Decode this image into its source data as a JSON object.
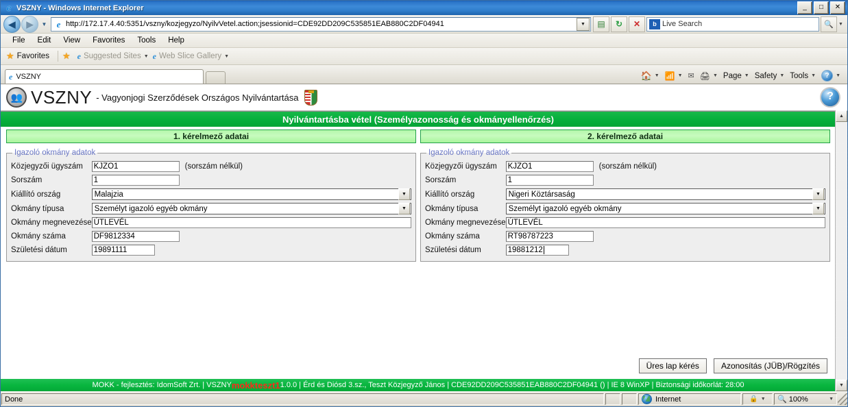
{
  "window": {
    "title": "VSZNY - Windows Internet Explorer",
    "minimize_label": "_",
    "maximize_label": "□",
    "close_label": "✕"
  },
  "nav": {
    "back_label": "◀",
    "forward_label": "▶",
    "recent_caret": "▼",
    "url": "http://172.17.4.40:5351/vszny/kozjegyzo/NyilvVetel.action;jsessionid=CDE92DD209C535851EAB880C2DF04941",
    "url_dropdown_label": "▼",
    "compat_icon": "compatibility-view-icon",
    "refresh_label": "↻",
    "stop_label": "✕",
    "search_brand": "b",
    "search_placeholder": "Live Search",
    "search_go_label": "🔍",
    "search_caret": "▼"
  },
  "menu": {
    "items": [
      "File",
      "Edit",
      "View",
      "Favorites",
      "Tools",
      "Help"
    ]
  },
  "favbar": {
    "favorites_label": "Favorites",
    "add_label": "",
    "suggested_sites": "Suggested Sites",
    "web_slice_gallery": "Web Slice Gallery",
    "caret": "▼"
  },
  "tabs": {
    "browser_tab_label": "VSZNY",
    "new_tab_label": ""
  },
  "commandbar": {
    "home_caret": "▼",
    "feeds_caret": "▼",
    "print_caret": "▼",
    "page": "Page",
    "safety": "Safety",
    "tools": "Tools",
    "help_label": "?",
    "caret": "▼"
  },
  "app": {
    "brand": "VSZNY",
    "brand_subtitle": "- Vagyonjogi Szerződések Országos Nyilvántartása",
    "help_label": "?",
    "page_title": "Nyilvántartásba vétel (Személyazonosság és okmányellenőrzés)"
  },
  "applicant_tabs": [
    {
      "label": "1. kérelmező adatai"
    },
    {
      "label": "2. kérelmező adatai"
    }
  ],
  "panels": [
    {
      "legend": "Igazoló okmány adatok",
      "fields": {
        "kozjegyzoi_ugyszam": {
          "label": "Közjegyzői ügyszám",
          "value": "KJZO1",
          "hint": "(sorszám nélkül)"
        },
        "sorszam": {
          "label": "Sorszám",
          "value": "1"
        },
        "kiallito_orszag": {
          "label": "Kiállító ország",
          "value": "Malajzia"
        },
        "okmany_tipusa": {
          "label": "Okmány típusa",
          "value": "Személyt igazoló egyéb okmány"
        },
        "okmany_megnevezese": {
          "label": "Okmány megnevezése",
          "value": "ÚTLEVÉL"
        },
        "okmany_szama": {
          "label": "Okmány száma",
          "value": "DF9812334"
        },
        "szuletesi_datum": {
          "label": "Születési dátum",
          "value": "19891111"
        }
      }
    },
    {
      "legend": "Igazoló okmány adatok",
      "fields": {
        "kozjegyzoi_ugyszam": {
          "label": "Közjegyzői ügyszám",
          "value": "KJZO1",
          "hint": "(sorszám nélkül)"
        },
        "sorszam": {
          "label": "Sorszám",
          "value": "1"
        },
        "kiallito_orszag": {
          "label": "Kiállító ország",
          "value": "Nigeri Köztársaság"
        },
        "okmany_tipusa": {
          "label": "Okmány típusa",
          "value": "Személyt igazoló egyéb okmány"
        },
        "okmany_megnevezese": {
          "label": "Okmány megnevezése",
          "value": "ÚTLEVÉL"
        },
        "okmany_szama": {
          "label": "Okmány száma",
          "value": "RT98787223"
        },
        "szuletesi_datum": {
          "label": "Születési dátum",
          "value": "19881212"
        }
      }
    }
  ],
  "actions": {
    "blank_page_request": "Üres lap kérés",
    "identify_register": "Azonosítás (JÜB)/Rögzítés"
  },
  "footer": {
    "part1": "MOKK - fejlesztés: IdomSoft Zrt.  | VSZNY ",
    "env": "mokkteszt1",
    "part2": " 1.0.0  | Érd és Diósd 3.sz., Teszt Közjegyző János  | CDE92DD209C535851EAB880C2DF04941 ()  | IE 8 WinXP  | Biztonsági időkorlát:  28:00"
  },
  "statusbar": {
    "status": "Done",
    "zone": "Internet",
    "zoom": "100%",
    "zoom_caret": "▼",
    "protected_caret": "▼"
  },
  "colors": {
    "accent_green": "#07b13d",
    "tab_green": "#b4f7ab",
    "title_blue": "#2a74c8",
    "env_red": "#ff2a1a"
  }
}
